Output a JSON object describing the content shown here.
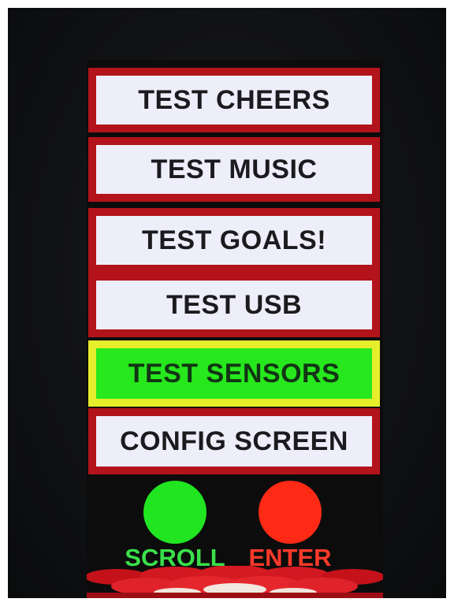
{
  "menu": {
    "items": [
      {
        "label": "TEST CHEERS",
        "selected": false
      },
      {
        "label": "TEST MUSIC",
        "selected": false
      },
      {
        "label": "TEST GOALS!",
        "selected": false
      },
      {
        "label": "TEST USB",
        "selected": false
      },
      {
        "label": "TEST SENSORS",
        "selected": true
      },
      {
        "label": "CONFIG SCREEN",
        "selected": false
      }
    ]
  },
  "controls": {
    "scroll": {
      "label": "SCROLL",
      "color": "#21e521"
    },
    "enter": {
      "label": "ENTER",
      "color": "#ff2a16"
    }
  },
  "colors": {
    "item_border": "#b3141c",
    "item_fill": "#eeeefb",
    "selected_border": "#e6ee2b",
    "selected_fill": "#27e81c",
    "scroll_label": "#39e04a",
    "enter_label": "#ff3a2a"
  }
}
